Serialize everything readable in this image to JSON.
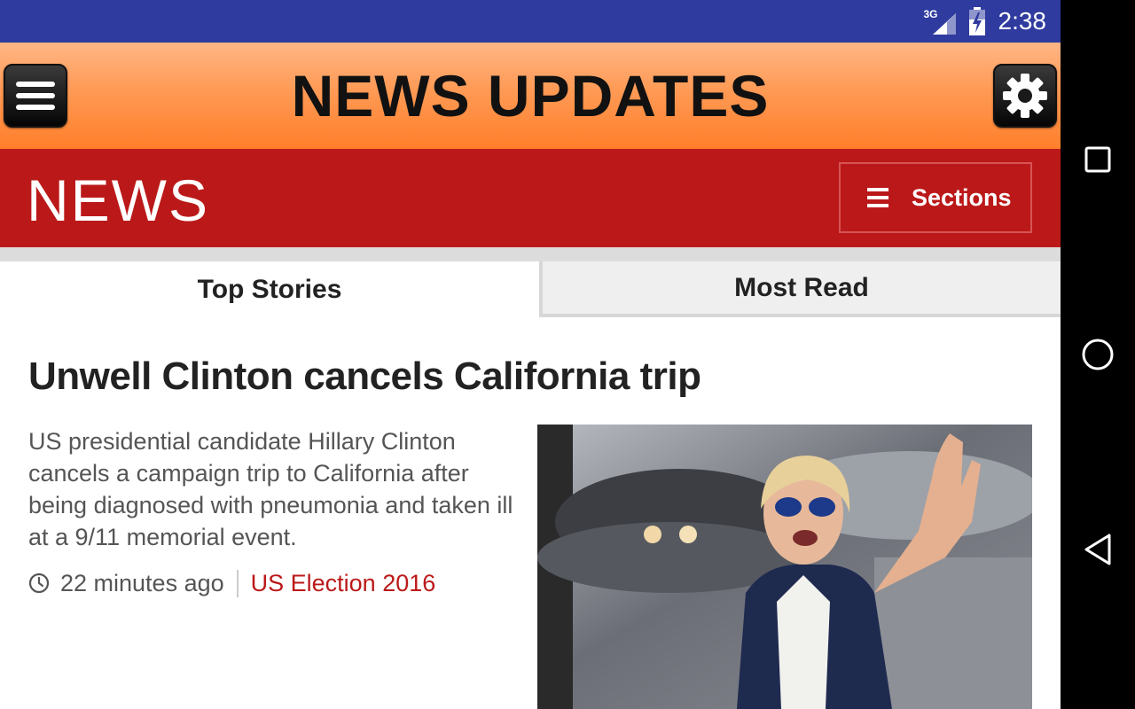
{
  "status_bar": {
    "network": "3G",
    "time": "2:38"
  },
  "header": {
    "title": "NEWS UPDATES",
    "menu_icon": "hamburger-menu-icon",
    "settings_icon": "gear-icon"
  },
  "news_bar": {
    "logo": "NEWS",
    "sections_label": "Sections"
  },
  "tabs": [
    {
      "label": "Top Stories",
      "selected": true
    },
    {
      "label": "Most Read",
      "selected": false
    }
  ],
  "article": {
    "headline": "Unwell Clinton cancels California trip",
    "summary": "US presidential candidate Hillary Clinton cancels a campaign trip to California after being diagnosed with pneumonia and taken ill at a 9/11 memorial event.",
    "time": "22 minutes ago",
    "section": "US Election 2016"
  },
  "colors": {
    "status_bar": "#2f3b9e",
    "header_orange": "#ff8a3d",
    "news_red": "#bb1919",
    "section_link": "#bb1919"
  }
}
